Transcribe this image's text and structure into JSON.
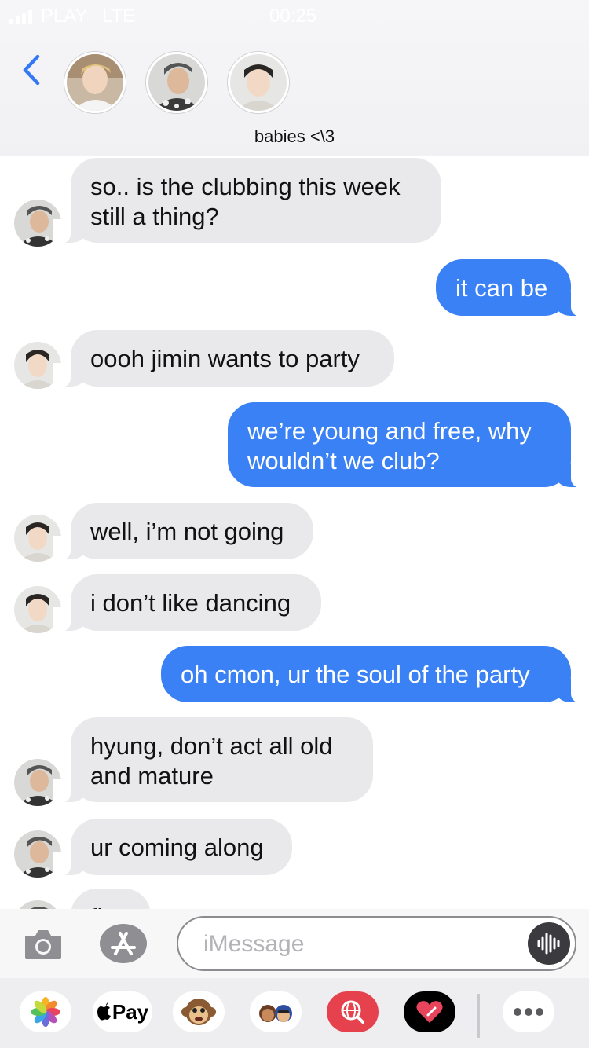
{
  "status_bar": {
    "carrier": "PLAY",
    "network": "LTE",
    "time": "00:25"
  },
  "header": {
    "group_name": "babies <\\3",
    "participants": [
      "participant-1",
      "participant-2",
      "participant-3"
    ]
  },
  "messages": [
    {
      "side": "in",
      "avatar": "tae",
      "text": "so.. is the clubbing this week\nstill a thing?"
    },
    {
      "side": "out",
      "text": "it can be"
    },
    {
      "side": "in",
      "avatar": "jin",
      "text": "oooh jimin wants to party"
    },
    {
      "side": "out",
      "text": "we’re young and free, why\nwouldn’t we club?"
    },
    {
      "side": "in",
      "avatar": "jin",
      "text": "well, i’m not going"
    },
    {
      "side": "in",
      "avatar": "jin",
      "text": "i don’t like dancing"
    },
    {
      "side": "out",
      "text": "oh cmon, ur the soul of the party"
    },
    {
      "side": "in",
      "avatar": "tae",
      "text": "hyung, don’t act all old\nand mature"
    },
    {
      "side": "in",
      "avatar": "tae",
      "text": "ur coming along"
    },
    {
      "side": "in",
      "avatar": "tae",
      "text": "fi"
    }
  ],
  "composer": {
    "placeholder": "iMessage"
  },
  "drawer": {
    "apps": [
      "photos-icon",
      "apple-pay-icon",
      "monkey-memoji-icon",
      "memoji-stickers-icon",
      "web-search-icon",
      "digital-touch-icon",
      "more-icon"
    ],
    "apple_pay_label": "Pay"
  },
  "colors": {
    "outgoing": "#3a81f5",
    "incoming": "#e9e9eb",
    "accent": "#3478f6"
  }
}
